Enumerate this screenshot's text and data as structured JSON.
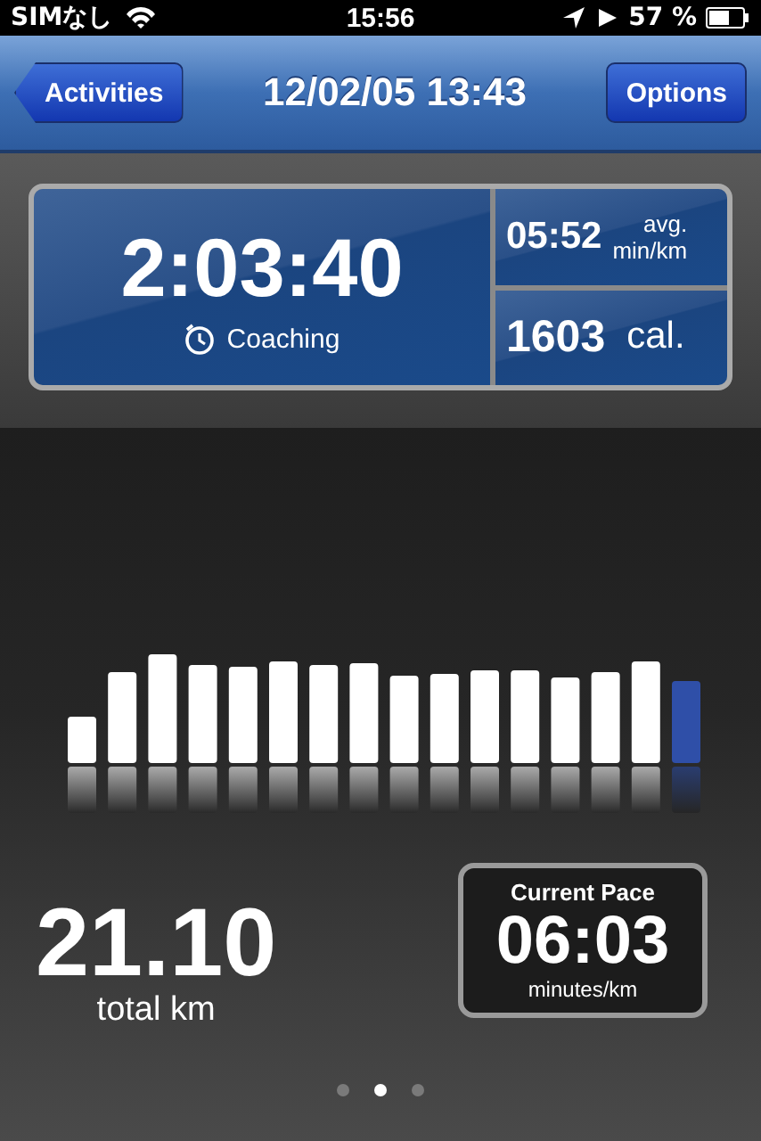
{
  "status_bar": {
    "carrier": "SIMなし",
    "time": "15:56",
    "battery": "57 %"
  },
  "nav_bar": {
    "back_button": "Activities",
    "title": "12/02/05 13:43",
    "options_button": "Options"
  },
  "summary": {
    "duration": "2:03:40",
    "coaching": "Coaching",
    "avg_pace": "05:52",
    "avg_label": "avg.",
    "avg_unit": "min/km",
    "calories": "1603",
    "calories_unit": "cal."
  },
  "distance": {
    "value": "21.10",
    "unit": "total km"
  },
  "current_pace": {
    "title": "Current Pace",
    "value": "06:03",
    "unit": "minutes/km"
  },
  "pages": [
    {
      "selected": false
    },
    {
      "selected": true
    },
    {
      "selected": false
    }
  ]
}
